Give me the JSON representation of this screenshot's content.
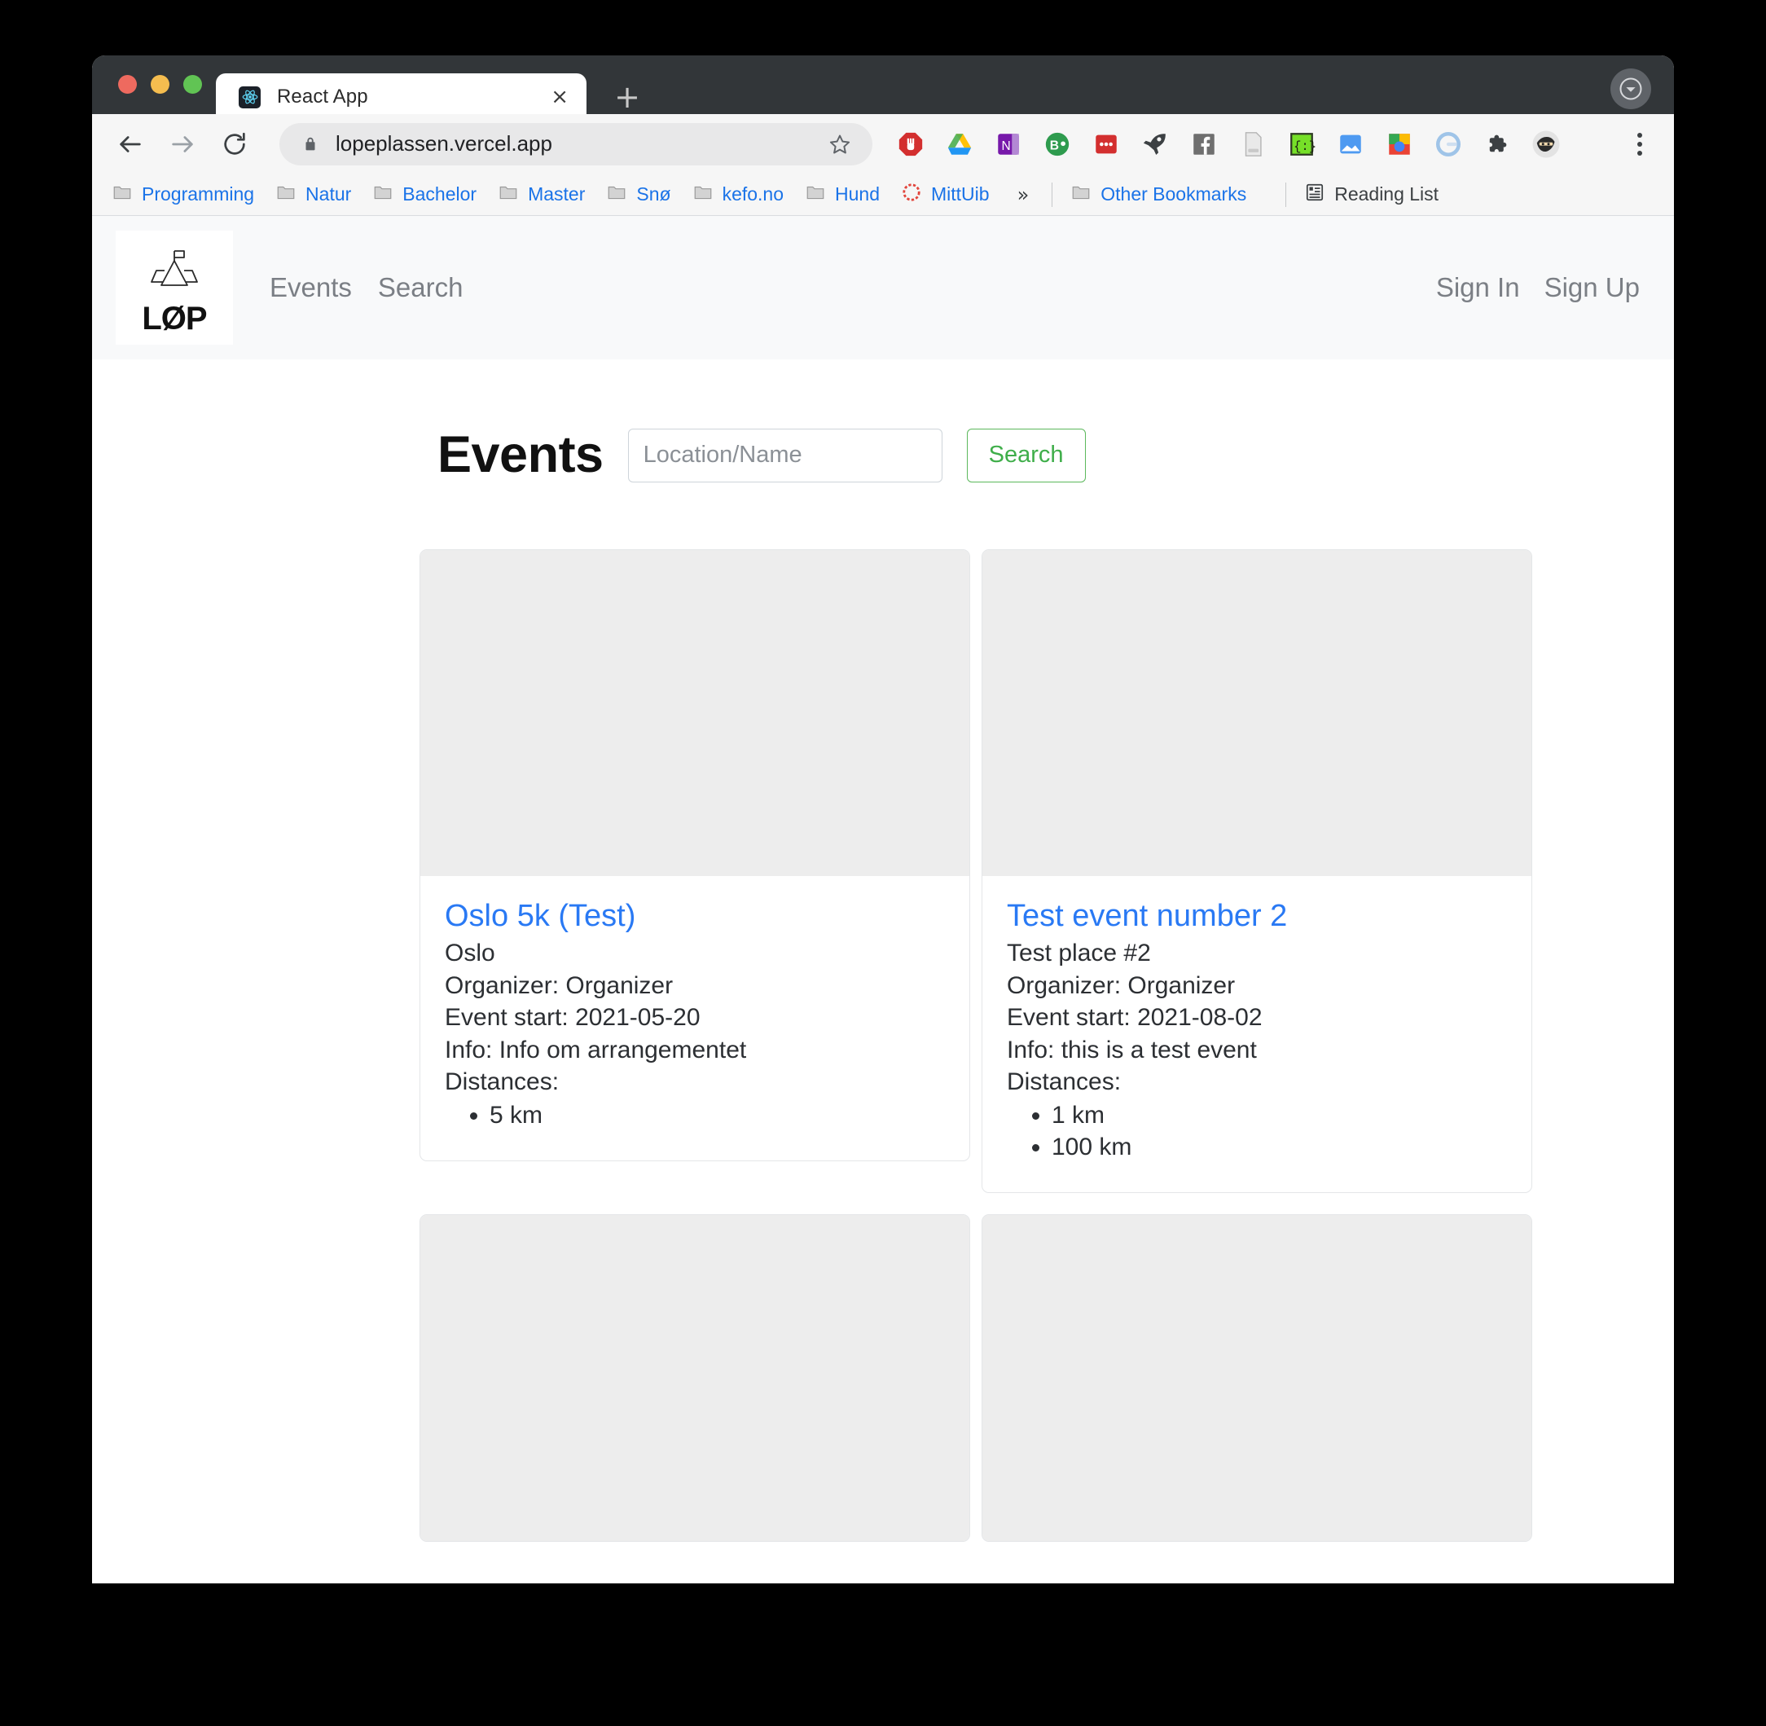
{
  "browser": {
    "tab": {
      "title": "React App",
      "favicon": "react-icon",
      "close_label": "×"
    },
    "new_tab_label": "+",
    "omnibox": {
      "url": "lopeplassen.vercel.app",
      "lock": "lock-icon",
      "star": "star-icon"
    },
    "nav": {
      "back": "back-arrow-icon",
      "forward": "forward-arrow-icon",
      "reload": "reload-icon"
    },
    "extensions": [
      {
        "name": "adblock-icon"
      },
      {
        "name": "google-drive-icon"
      },
      {
        "name": "onenote-icon"
      },
      {
        "name": "bitwarden-icon"
      },
      {
        "name": "lastpass-icon"
      },
      {
        "name": "rocket-icon"
      },
      {
        "name": "facebook-icon"
      },
      {
        "name": "document-icon"
      },
      {
        "name": "code-braces-icon"
      },
      {
        "name": "screenshot-icon"
      },
      {
        "name": "google-optimize-icon"
      },
      {
        "name": "grammarly-icon"
      },
      {
        "name": "puzzle-extensions-icon"
      },
      {
        "name": "ninja-avatar-icon"
      }
    ],
    "menu_label": "chrome-menu-kebab",
    "bookmarks": [
      {
        "label": "Programming",
        "icon": "folder-icon",
        "dark": false
      },
      {
        "label": "Natur",
        "icon": "folder-icon",
        "dark": false
      },
      {
        "label": "Bachelor",
        "icon": "folder-icon",
        "dark": false
      },
      {
        "label": "Master",
        "icon": "folder-icon",
        "dark": false
      },
      {
        "label": "Snø",
        "icon": "folder-icon",
        "dark": false
      },
      {
        "label": "kefo.no",
        "icon": "folder-icon",
        "dark": false
      },
      {
        "label": "Hund",
        "icon": "folder-icon",
        "dark": false
      },
      {
        "label": "MittUib",
        "icon": "mittuib-icon",
        "dark": false
      }
    ],
    "overflow_label": "»",
    "other_bookmarks": {
      "label": "Other Bookmarks",
      "icon": "folder-icon"
    },
    "reading_list": {
      "label": "Reading List",
      "icon": "reading-list-icon"
    }
  },
  "site": {
    "brand": {
      "text": "LØP",
      "icon": "mountain-flag-logo"
    },
    "nav_links": [
      {
        "label": "Events"
      },
      {
        "label": "Search"
      }
    ],
    "auth_links": [
      {
        "label": "Sign In"
      },
      {
        "label": "Sign Up"
      }
    ],
    "page_title": "Events",
    "search": {
      "placeholder": "Location/Name",
      "value": "",
      "button_label": "Search",
      "button_color": "#3fae4a"
    },
    "events": [
      {
        "title": "Oslo 5k (Test)",
        "place": "Oslo",
        "organizer": "Organizer: Organizer",
        "start": "Event start: 2021-05-20",
        "info": "Info: Info om arrangementet",
        "distances_label": "Distances:",
        "distances": [
          "5 km"
        ]
      },
      {
        "title": "Test event number 2",
        "place": "Test place #2",
        "organizer": "Organizer: Organizer",
        "start": "Event start: 2021-08-02",
        "info": "Info: this is a test event",
        "distances_label": "Distances:",
        "distances": [
          "1 km",
          "100 km"
        ]
      },
      {
        "title": "",
        "place": "",
        "organizer": "",
        "start": "",
        "info": "",
        "distances_label": "",
        "distances": []
      },
      {
        "title": "",
        "place": "",
        "organizer": "",
        "start": "",
        "info": "",
        "distances_label": "",
        "distances": []
      }
    ]
  }
}
